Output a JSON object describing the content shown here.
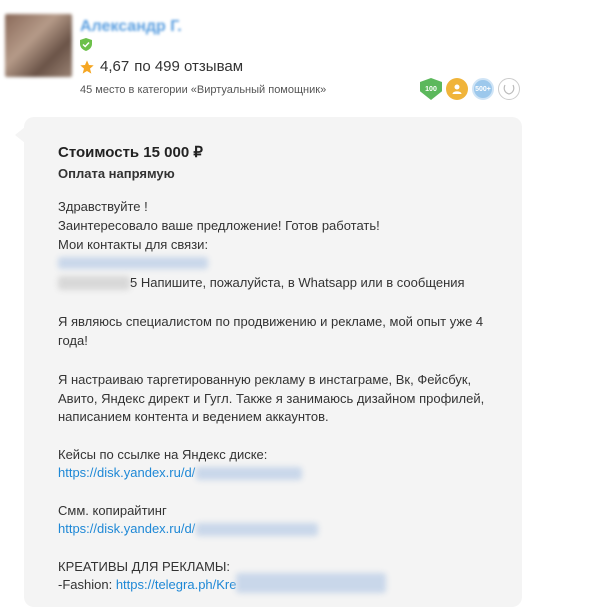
{
  "header": {
    "name": "Александр Г.",
    "rating_value": "4,67",
    "rating_text": "по 499 отзывам",
    "category_rank": "45 место в категории «Виртуальный помощник»",
    "badges": [
      {
        "icon": "shield-badge-icon",
        "label": "100"
      },
      {
        "icon": "person-badge-icon",
        "label": ""
      },
      {
        "icon": "count-badge-icon",
        "label": "500+"
      },
      {
        "icon": "laurel-badge-icon",
        "label": ""
      }
    ]
  },
  "offer": {
    "price": "Стоимость 15 000 ₽",
    "payment": "Оплата напрямую",
    "lines": {
      "l1": "Здравствуйте !",
      "l2": "Заинтересовало ваше предложение! Готов работать!",
      "l3": "Мои контакты для связи:",
      "l4": "5 Напишите, пожалуйста, в Whatsapp или в сообщения",
      "l5": "Я являюсь специалистом по продвижению и рекламе, мой опыт уже 4",
      "l6": "года!",
      "l7": "Я настраиваю таргетированную рекламу в инстаграме, Вк, Фейсбук,",
      "l8": "Авито, Яндекс директ и Гугл. Также я занимаюсь дизайном профилей,",
      "l9": "написанием контента и ведением аккаунтов.",
      "l10": "Кейсы по ссылке на Яндекс диске:",
      "l11": "https://disk.yandex.ru/d/",
      "l12": "Смм. копирайтинг",
      "l13": "https://disk.yandex.ru/d/",
      "l14": "КРЕАТИВЫ ДЛЯ РЕКЛАМЫ:",
      "l15_prefix": "-Fashion: ",
      "l15_link": "https://telegra.ph/Kre"
    }
  },
  "colors": {
    "accent": "#1e88d6",
    "star": "#f5a623",
    "bubble": "#f4f4f4"
  }
}
